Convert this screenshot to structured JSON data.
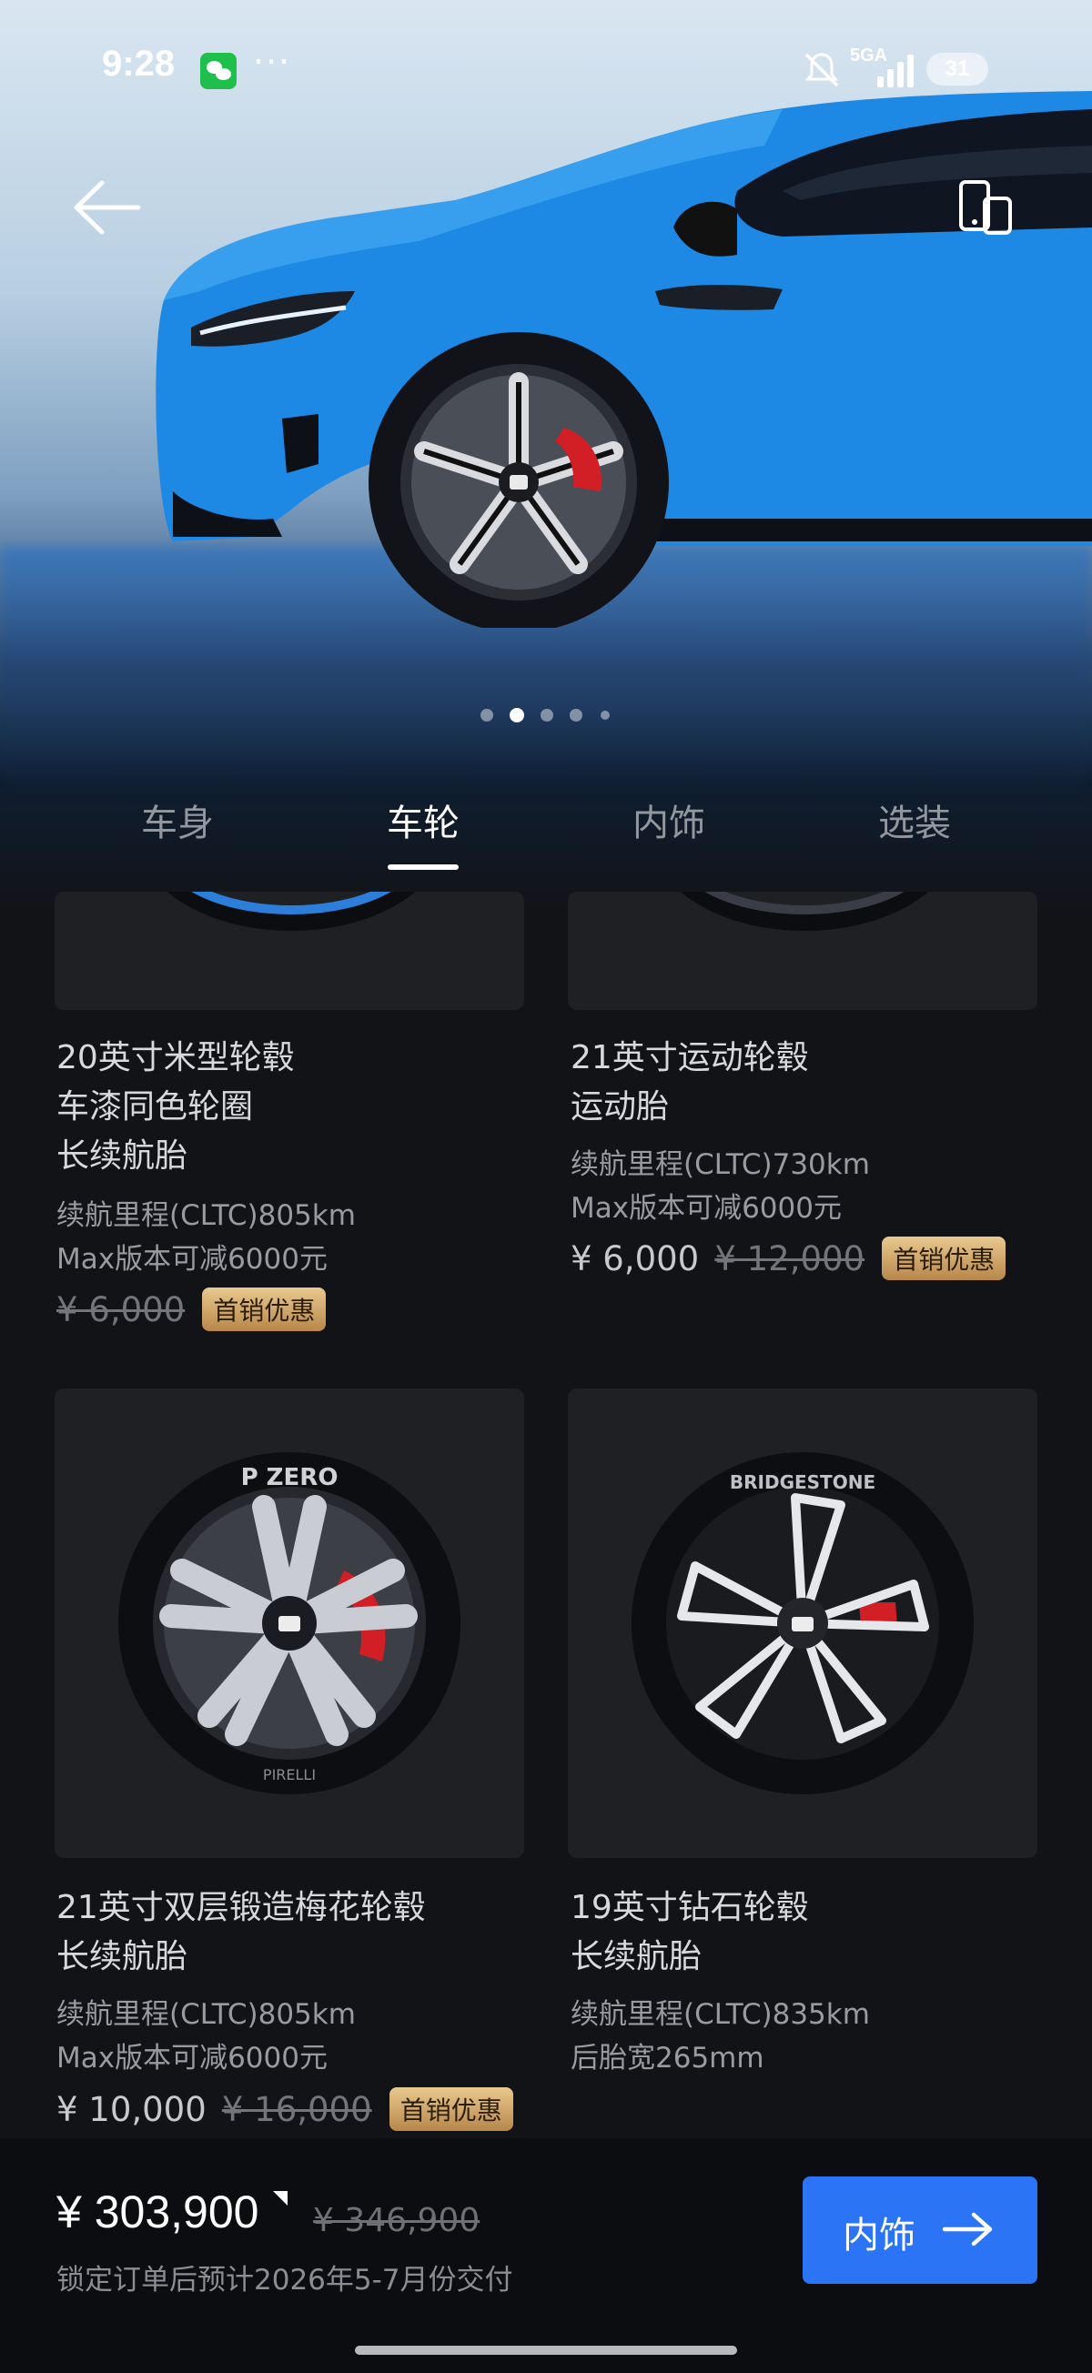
{
  "status_bar": {
    "time": "9:28",
    "network": "5GA",
    "battery": "31"
  },
  "hero": {
    "carousel_total": 5,
    "carousel_active": 1
  },
  "tabs": [
    {
      "label": "车身",
      "active": false
    },
    {
      "label": "车轮",
      "active": true
    },
    {
      "label": "内饰",
      "active": false
    },
    {
      "label": "选装",
      "active": false
    }
  ],
  "wheels": [
    {
      "title_lines": [
        "20英寸米型轮毂",
        "车漆同色轮圈",
        "长续航胎"
      ],
      "meta_lines": [
        "续航里程(CLTC)805km",
        "Max版本可减6000元"
      ],
      "price": "",
      "price_old": "¥ 6,000",
      "promo": "首销优惠"
    },
    {
      "title_lines": [
        "21英寸运动轮毂",
        "运动胎"
      ],
      "meta_lines": [
        "续航里程(CLTC)730km",
        "Max版本可减6000元"
      ],
      "price": "¥ 6,000",
      "price_old": "¥ 12,000",
      "promo": "首销优惠"
    },
    {
      "title_lines": [
        "21英寸双层锻造梅花轮毂",
        "长续航胎"
      ],
      "meta_lines": [
        "续航里程(CLTC)805km",
        "Max版本可减6000元"
      ],
      "price": "¥ 10,000",
      "price_old": "¥ 16,000",
      "promo": "首销优惠",
      "tire_text": "P ZERO",
      "tire_brand": "PIRELLI"
    },
    {
      "title_lines": [
        "19英寸钻石轮毂",
        "长续航胎"
      ],
      "meta_lines": [
        "续航里程(CLTC)835km",
        "后胎宽265mm"
      ],
      "tire_text": "BRIDGESTONE"
    }
  ],
  "bottom_bar": {
    "total_price": "¥ 303,900",
    "original_price": "¥ 346,900",
    "delivery_note": "锁定订单后预计2026年5-7月份交付",
    "next_button": "内饰"
  },
  "colors": {
    "car_body": "#1e88e5",
    "brake_caliper": "#d21f26",
    "accent_button": "#2a74f5",
    "promo_badge": "#d4a86a"
  }
}
